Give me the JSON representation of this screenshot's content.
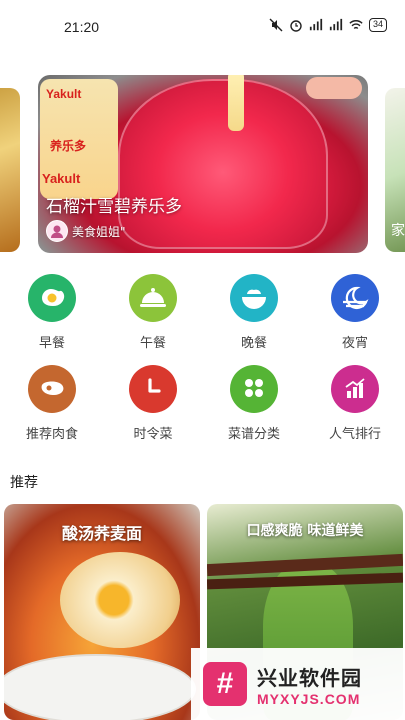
{
  "status_bar": {
    "time": "21:20",
    "battery": "34",
    "icons": [
      "mute-icon",
      "alarm-icon",
      "signal-hd-icon",
      "signal-hd-icon",
      "wifi-icon",
      "battery-icon"
    ]
  },
  "carousel": {
    "main": {
      "title": "石榴汁雪碧养乐多",
      "author": "美食姐姐\"",
      "bottle_brand": "Yakult",
      "bottle_text": "养乐多"
    },
    "right_peek_text": "家"
  },
  "categories": [
    {
      "label": "早餐",
      "icon": "egg-icon",
      "color": "#27b46a"
    },
    {
      "label": "午餐",
      "icon": "cloche-icon",
      "color": "#8cc43a"
    },
    {
      "label": "晚餐",
      "icon": "bowl-icon",
      "color": "#22b4c6"
    },
    {
      "label": "夜宵",
      "icon": "moon-icon",
      "color": "#2f62d6"
    },
    {
      "label": "推荐肉食",
      "icon": "meat-icon",
      "color": "#c4672f"
    },
    {
      "label": "时令菜",
      "icon": "clock-icon",
      "color": "#d9392e"
    },
    {
      "label": "菜谱分类",
      "icon": "grid-icon",
      "color": "#55b435"
    },
    {
      "label": "人气排行",
      "icon": "chart-icon",
      "color": "#cc2d8f"
    }
  ],
  "section": {
    "title": "推荐"
  },
  "recommendations": [
    {
      "caption": "酸汤荞麦面"
    },
    {
      "caption": "口感爽脆 味道鲜美"
    }
  ],
  "watermark": {
    "logo_char": "#",
    "main": "兴业软件园",
    "sub": "MYXYJS.COM",
    "brand_color": "#e4316f"
  }
}
